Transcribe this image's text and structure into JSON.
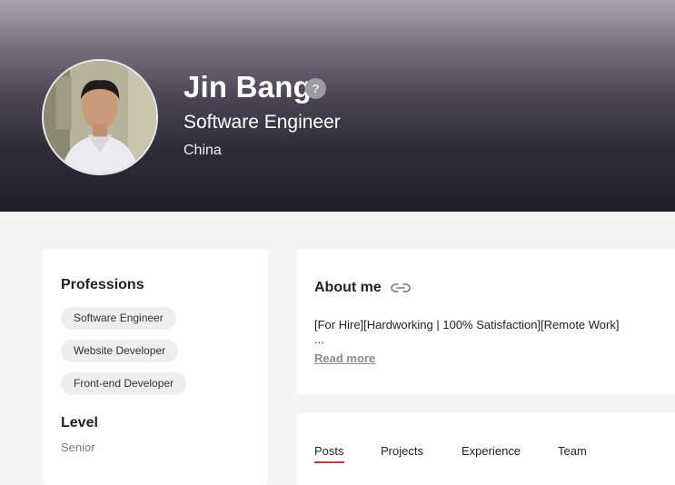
{
  "profile": {
    "name": "Jin Bang",
    "verify_badge": "?",
    "title": "Software Engineer",
    "location": "China",
    "avatar_icon": "profile-photo"
  },
  "professions": {
    "heading": "Professions",
    "chips": [
      "Software Engineer",
      "Website Developer",
      "Front-end Developer"
    ]
  },
  "level": {
    "heading": "Level",
    "value": "Senior"
  },
  "about": {
    "heading": "About me",
    "link_icon": "link-icon",
    "text": "[For Hire][Hardworking | 100% Satisfaction][Remote Work]",
    "ellipsis": "...",
    "read_more": "Read more"
  },
  "tabs": {
    "items": [
      "Posts",
      "Projects",
      "Experience",
      "Team"
    ],
    "active": "Posts",
    "accent_color": "#c43c3c"
  }
}
